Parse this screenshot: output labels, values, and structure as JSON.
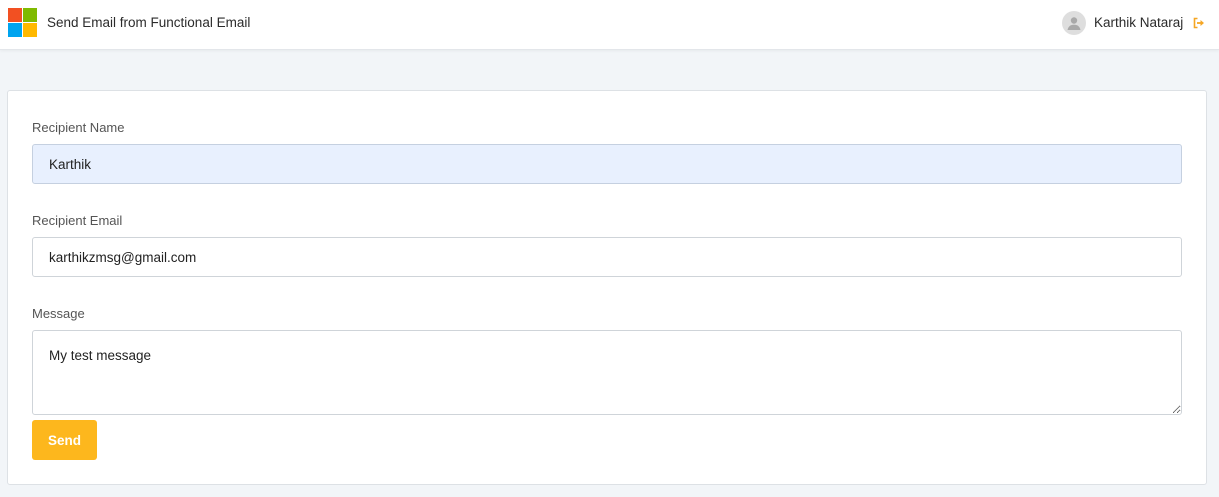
{
  "header": {
    "app_title": "Send Email from Functional Email",
    "user_name": "Karthik Nataraj",
    "logo_colors": [
      "#f25022",
      "#7fba00",
      "#00a4ef",
      "#ffb900"
    ],
    "logout_icon": "sign-out-icon",
    "avatar_icon": "user-avatar-icon"
  },
  "form": {
    "recipient_name": {
      "label": "Recipient Name",
      "value": "Karthik"
    },
    "recipient_email": {
      "label": "Recipient Email",
      "value": "karthikzmsg@gmail.com"
    },
    "message": {
      "label": "Message",
      "value": "My test message"
    },
    "send_label": "Send"
  },
  "colors": {
    "accent": "#fdb71d",
    "autofill_bg": "#e8f0fe",
    "page_bg": "#f2f5f8"
  }
}
